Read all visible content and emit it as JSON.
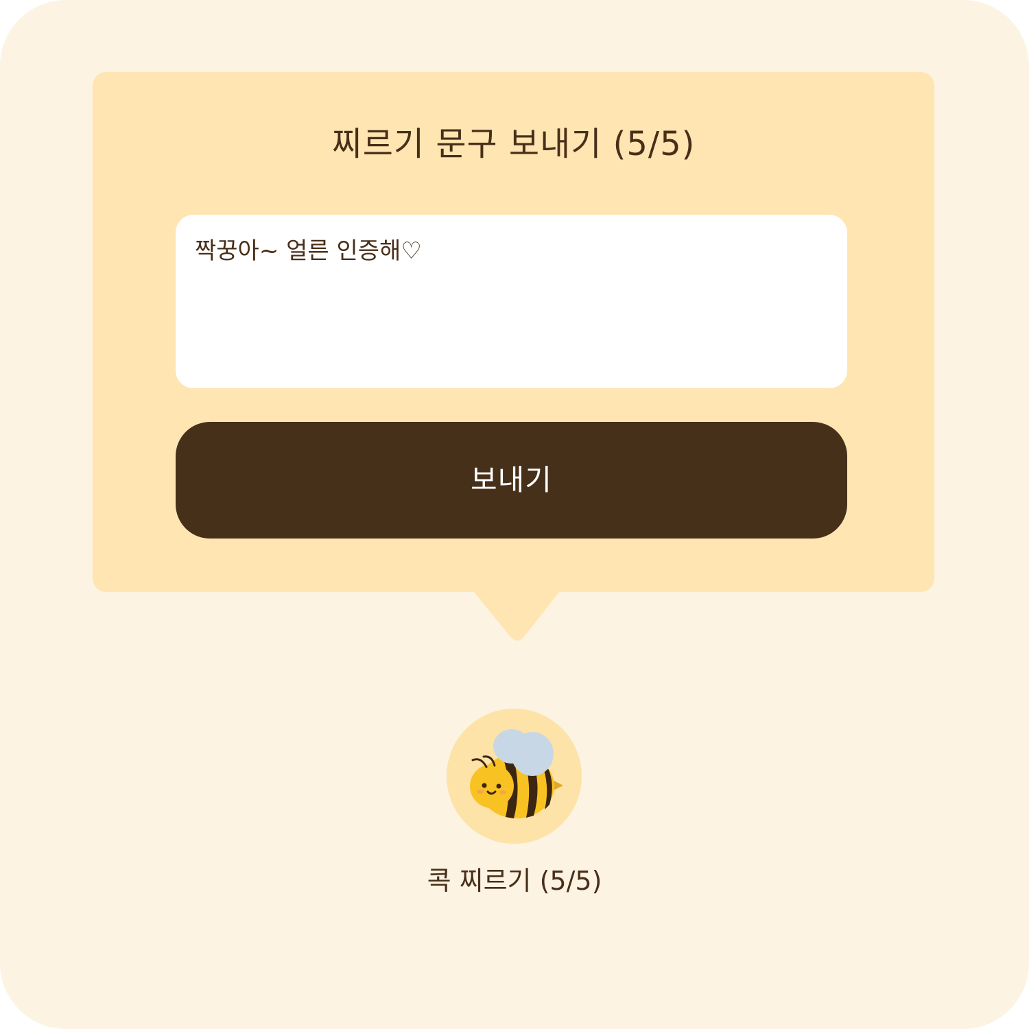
{
  "dialog": {
    "title": "찌르기 문구 보내기 (5/5)",
    "message": {
      "value": "짝꿍아~ 얼른 인증해♡"
    },
    "send_button_label": "보내기"
  },
  "poke": {
    "icon": "bee-icon",
    "label": "콕 찌르기 (5/5)"
  },
  "colors": {
    "background": "#fcf3e3",
    "bubble": "#fee5b1",
    "accent_dark": "#47301a",
    "text": "#482f19",
    "avatar_bg": "#fde3a7"
  }
}
